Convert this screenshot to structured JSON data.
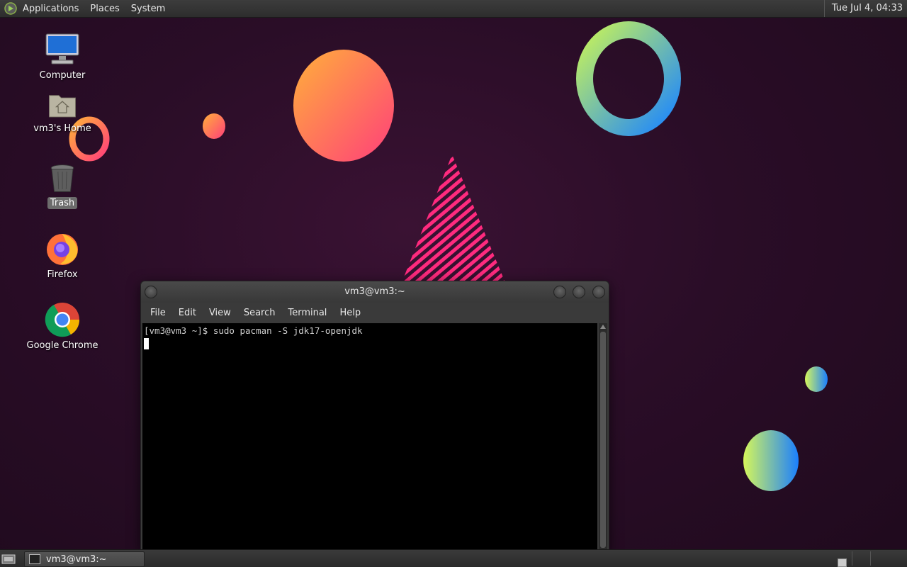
{
  "top_panel": {
    "menus": [
      "Applications",
      "Places",
      "System"
    ],
    "clock": "Tue Jul  4, 04:33"
  },
  "desktop_icons": [
    {
      "label": "Computer",
      "icon": "computer-icon"
    },
    {
      "label": "vm3's Home",
      "icon": "home-folder-icon"
    },
    {
      "label": "Trash",
      "icon": "trash-icon"
    },
    {
      "label": "Firefox",
      "icon": "firefox-icon"
    },
    {
      "label": "Google Chrome",
      "icon": "chrome-icon"
    }
  ],
  "terminal": {
    "title": "vm3@vm3:~",
    "menus": [
      "File",
      "Edit",
      "View",
      "Search",
      "Terminal",
      "Help"
    ],
    "prompt_line": "[vm3@vm3 ~]$ sudo pacman -S jdk17-openjdk"
  },
  "taskbar": {
    "task_label": "vm3@vm3:~"
  },
  "colors": {
    "wallpaper": "#2a0d27",
    "panel": "#333333",
    "terminal_bg": "#000000"
  }
}
